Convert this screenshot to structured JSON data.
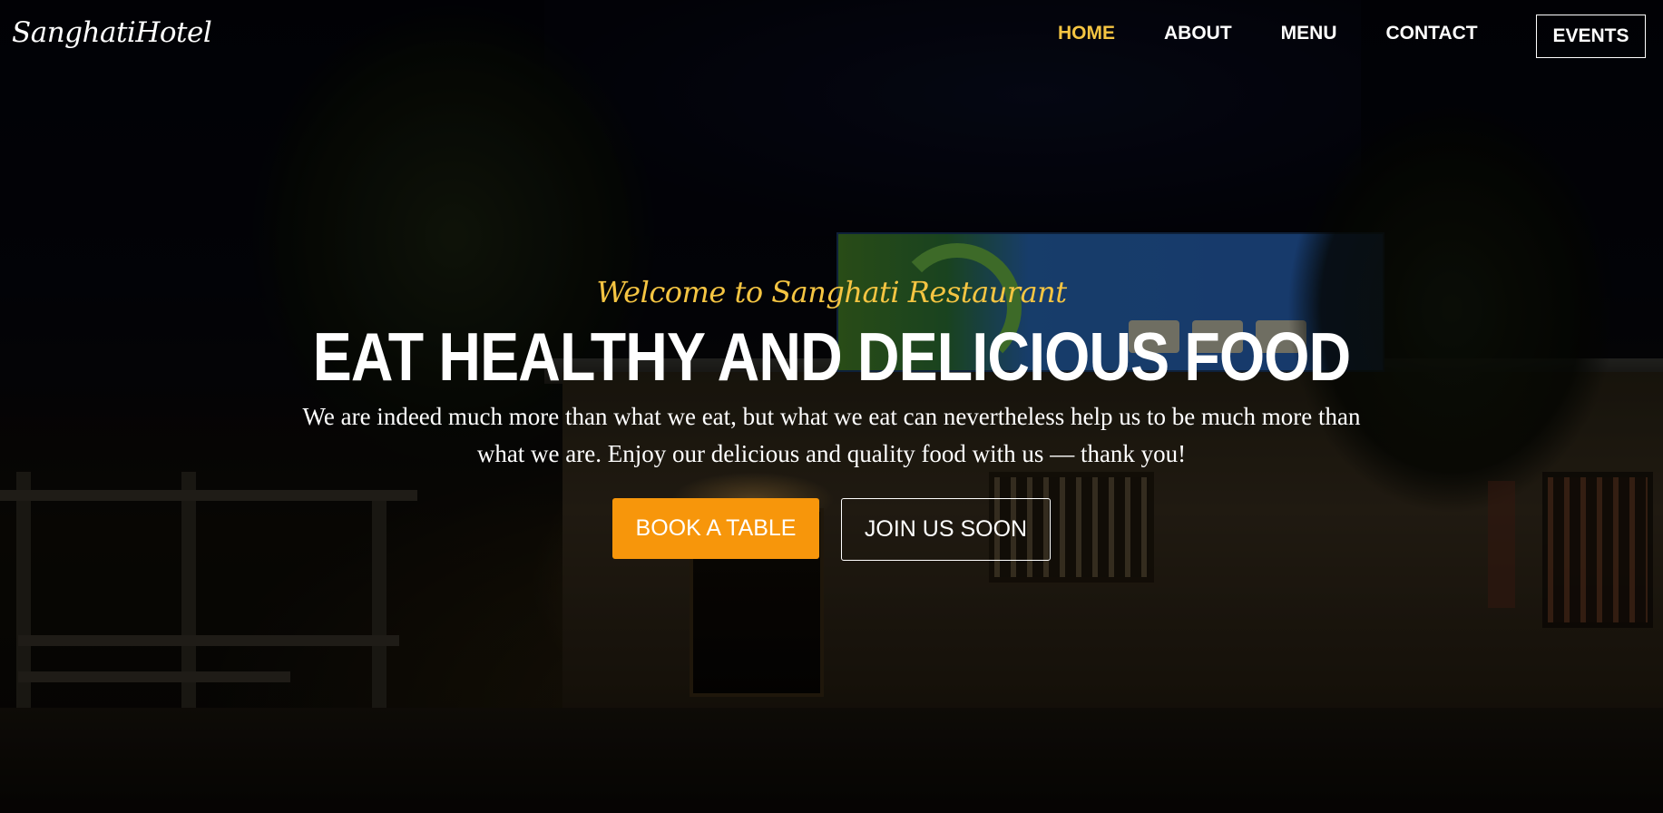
{
  "header": {
    "logo": "SanghatiHotel",
    "nav": [
      {
        "label": "HOME",
        "active": true
      },
      {
        "label": "ABOUT",
        "active": false
      },
      {
        "label": "MENU",
        "active": false
      },
      {
        "label": "CONTACT",
        "active": false
      }
    ],
    "events_label": "EVENTS"
  },
  "hero": {
    "welcome": "Welcome to Sanghati Restaurant",
    "headline": "EAT HEALTHY AND DELICIOUS FOOD",
    "description": "We are indeed much more than what we eat, but what we eat can nevertheless help us to be much more than what we are. Enjoy our delicious and quality food with us — thank you!",
    "primary_cta": "BOOK A TABLE",
    "secondary_cta": "JOIN US SOON"
  },
  "colors": {
    "accent_yellow": "#f5c542",
    "cta_orange": "#f7960b",
    "text_white": "#ffffff"
  }
}
